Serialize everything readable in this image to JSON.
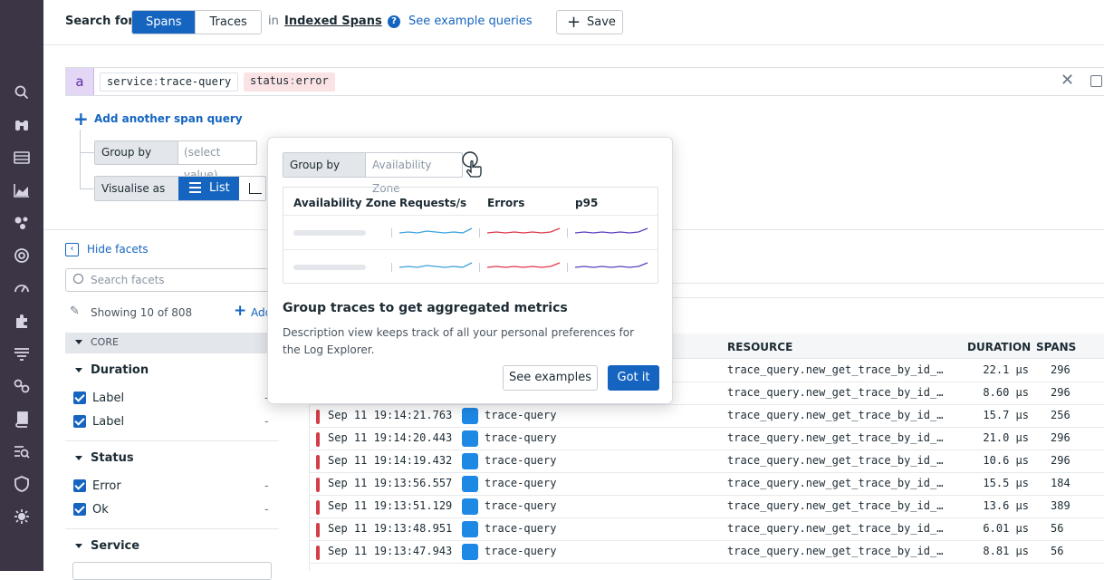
{
  "topbar": {
    "search_for_label": "Search for",
    "tabs": [
      "Spans",
      "Traces"
    ],
    "in_label": "in",
    "index_label": "Indexed Spans",
    "example_queries_label": "See example queries",
    "save_label": "Save"
  },
  "query": {
    "letter": "a",
    "chips": [
      {
        "key": "service",
        "value": "trace-query"
      },
      {
        "key": "status",
        "value": "error"
      }
    ],
    "add_query_label": "Add another span query",
    "group_by_label": "Group by",
    "group_by_placeholder": "(select value)",
    "visualise_as_label": "Visualise as",
    "visualise_option": "List"
  },
  "popover": {
    "group_by_label": "Group by",
    "group_by_value": "Availability Zone",
    "columns": [
      "Availability Zone",
      "Requests/s",
      "Errors",
      "p95"
    ],
    "title": "Group traces to get aggregated metrics",
    "description": "Description view keeps track of all your personal preferences for the Log Explorer.",
    "see_examples_label": "See examples",
    "got_it_label": "Got it",
    "colors": {
      "requests": "#3aa1e0",
      "errors": "#e0364a",
      "p95": "#5b3fbf"
    }
  },
  "facets": {
    "hide_label": "Hide facets",
    "search_placeholder": "Search facets",
    "showing_label": "Showing 10 of 808",
    "add_label": "Add",
    "core_label": "CORE",
    "groups": [
      {
        "title": "Duration",
        "items": [
          {
            "label": "Label",
            "value": "-"
          },
          {
            "label": "Label",
            "value": "-"
          }
        ]
      },
      {
        "title": "Status",
        "items": [
          {
            "label": "Error",
            "value": "-"
          },
          {
            "label": "Ok",
            "value": "-"
          }
        ]
      },
      {
        "title": "Service",
        "items": []
      }
    ]
  },
  "table": {
    "headers": {
      "resource": "RESOURCE",
      "duration": "DURATION",
      "spans": "SPANS"
    },
    "rows": [
      {
        "date": "",
        "service": "",
        "resource": "trace_query.new_get_trace_by_id_…",
        "duration": "22.1 µs",
        "spans": "296"
      },
      {
        "date": "",
        "service": "",
        "resource": "trace_query.new_get_trace_by_id_…",
        "duration": "8.60 µs",
        "spans": "296"
      },
      {
        "date": "Sep 11 19:14:21.763",
        "service": "trace-query",
        "resource": "trace_query.new_get_trace_by_id_…",
        "duration": "15.7 µs",
        "spans": "256"
      },
      {
        "date": "Sep 11 19:14:20.443",
        "service": "trace-query",
        "resource": "trace_query.new_get_trace_by_id_…",
        "duration": "21.0 µs",
        "spans": "296"
      },
      {
        "date": "Sep 11 19:14:19.432",
        "service": "trace-query",
        "resource": "trace_query.new_get_trace_by_id_…",
        "duration": "10.6 µs",
        "spans": "296"
      },
      {
        "date": "Sep 11 19:13:56.557",
        "service": "trace-query",
        "resource": "trace_query.new_get_trace_by_id_…",
        "duration": "15.5 µs",
        "spans": "184"
      },
      {
        "date": "Sep 11 19:13:51.129",
        "service": "trace-query",
        "resource": "trace_query.new_get_trace_by_id_…",
        "duration": "13.6 µs",
        "spans": "389"
      },
      {
        "date": "Sep 11 19:13:48.951",
        "service": "trace-query",
        "resource": "trace_query.new_get_trace_by_id_…",
        "duration": "6.01 µs",
        "spans": "56"
      },
      {
        "date": "Sep 11 19:13:47.943",
        "service": "trace-query",
        "resource": "trace_query.new_get_trace_by_id_…",
        "duration": "8.81 µs",
        "spans": "56"
      }
    ]
  },
  "nav_icons": [
    "search-icon",
    "binoculars-icon",
    "list-icon",
    "area-chart-icon",
    "dots-icon",
    "target-icon",
    "gauge-icon",
    "puzzle-icon",
    "filter-list-icon",
    "link-icon",
    "book-icon",
    "logs-search-icon",
    "shield-icon",
    "gear-bug-icon"
  ]
}
